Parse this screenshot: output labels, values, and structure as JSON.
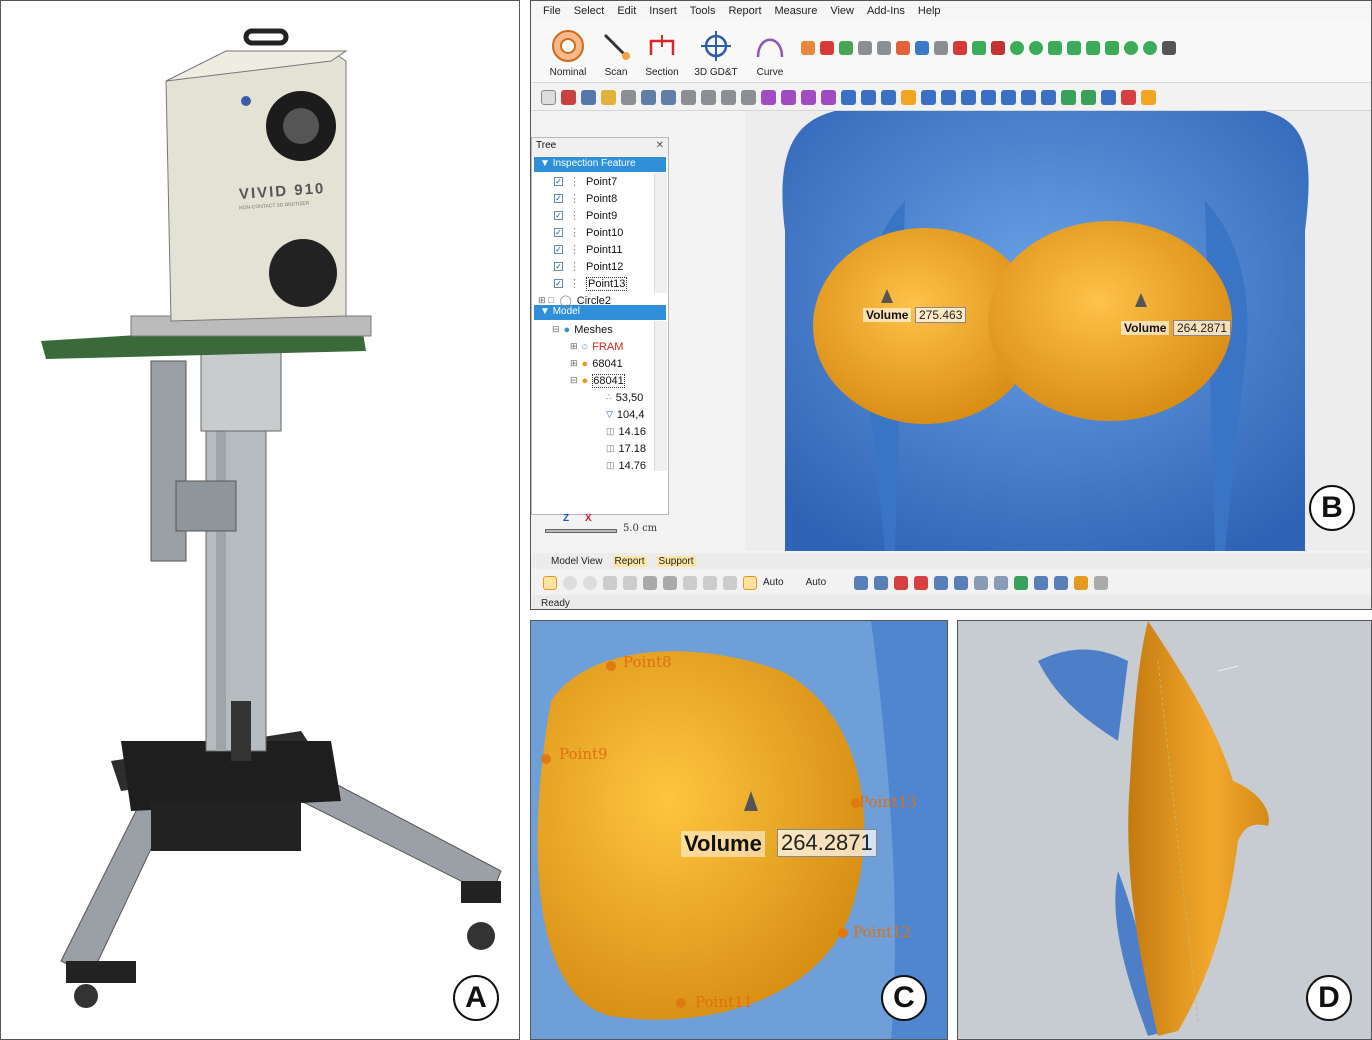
{
  "panel_labels": {
    "a": "A",
    "b": "B",
    "c": "C",
    "d": "D"
  },
  "device": {
    "brand_text": "VIVID 910",
    "subtitle": "NON-CONTACT 3D DIGITIZER"
  },
  "menu": [
    "File",
    "Select",
    "Edit",
    "Insert",
    "Tools",
    "Report",
    "Measure",
    "View",
    "Add-Ins",
    "Help"
  ],
  "ribbon": [
    {
      "label": "Nominal",
      "icon": "target-disc-icon"
    },
    {
      "label": "Scan",
      "icon": "scan-wand-icon"
    },
    {
      "label": "Section",
      "icon": "section-cut-icon"
    },
    {
      "label": "3D GD&T",
      "icon": "crosshair-icon"
    },
    {
      "label": "Curve",
      "icon": "curve-icon"
    }
  ],
  "tree": {
    "title": "Tree",
    "inspection_header": "Inspection Feature",
    "points": [
      "Point7",
      "Point8",
      "Point9",
      "Point10",
      "Point11",
      "Point12",
      "Point13"
    ],
    "circle": "Circle2",
    "model_header": "Model",
    "meshes": "Meshes",
    "mesh_items": [
      "FRAM",
      "68041",
      "68041"
    ],
    "values": [
      "53,50",
      "104,4",
      "14.16",
      "17.18",
      "14.76"
    ]
  },
  "scale": {
    "axis_z": "Z",
    "axis_x": "X",
    "length": "5.0 cm"
  },
  "tabs": [
    "Model View",
    "Report",
    "Support"
  ],
  "bottom_toolbar": {
    "auto1": "Auto",
    "auto2": "Auto"
  },
  "status": "Ready",
  "measure": {
    "left": {
      "label": "Volume",
      "value": "275.463"
    },
    "right": {
      "label": "Volume",
      "value": "264.2871"
    }
  },
  "zoom_points": [
    "Point8",
    "Point9",
    "Point13",
    "Point12",
    "Point11"
  ],
  "colors": {
    "body": "#4f88d3",
    "breast": "#f0a628",
    "accent": "#2f8fd8"
  }
}
